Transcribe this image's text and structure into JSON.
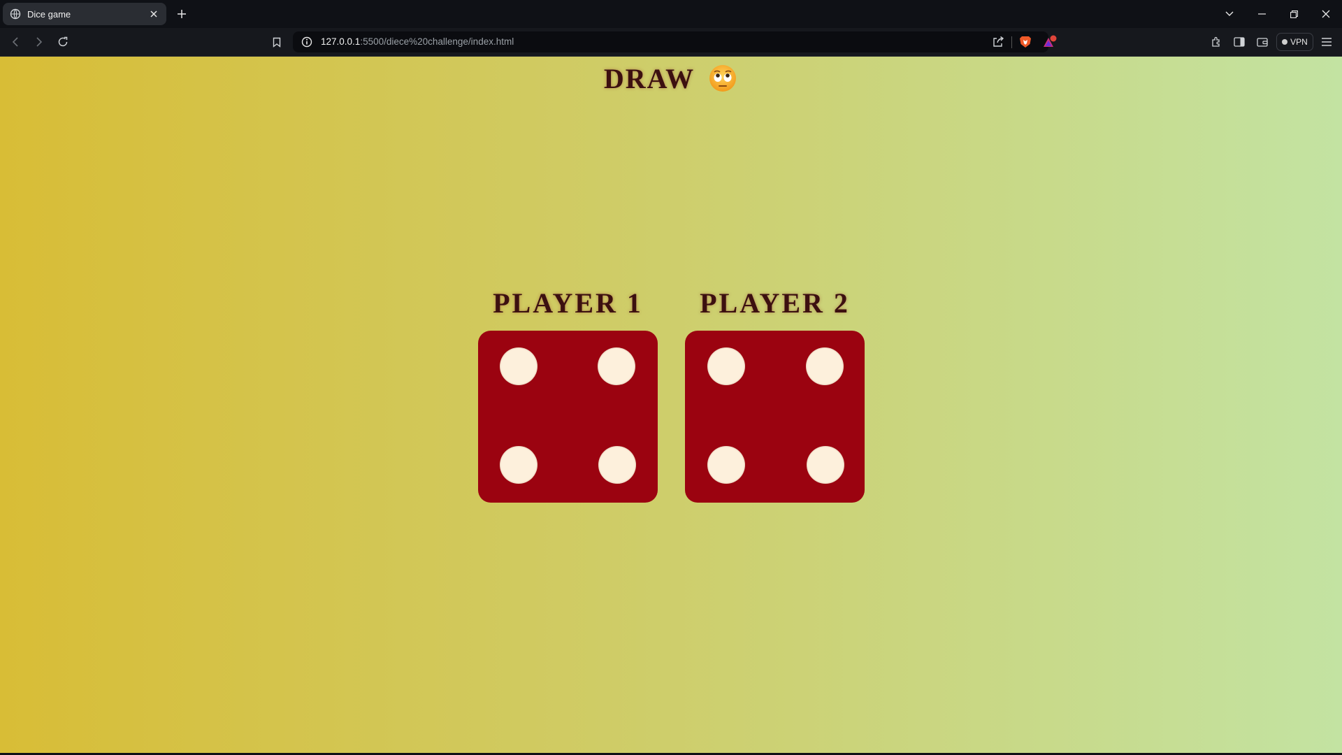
{
  "browser": {
    "tab": {
      "title": "Dice game"
    },
    "url": {
      "host": "127.0.0.1",
      "rest": ":5500/diece%20challenge/index.html"
    },
    "vpn_label": "VPN",
    "rewards_badge_color": "#e0453a"
  },
  "page": {
    "heading": "DRAW",
    "heading_emoji": "face-with-rolling-eyes",
    "background_gradient": [
      "#d8bd36",
      "#cfcc66",
      "#c3e3a2"
    ],
    "text_color": "#3c1010",
    "players": [
      {
        "label": "PLAYER 1",
        "die_value": 4
      },
      {
        "label": "PLAYER 2",
        "die_value": 4
      }
    ],
    "die_color": "#9b0310",
    "pip_color": "#fdf0dc"
  }
}
